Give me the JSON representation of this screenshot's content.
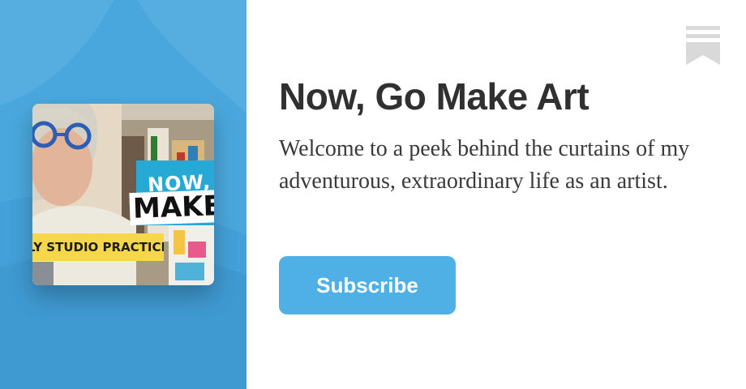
{
  "publication": {
    "title": "Now, Go Make Art",
    "description": "Welcome to a peek behind the curtains of my adventurous, extraordinary life as an artist.",
    "subscribe_label": "Subscribe"
  },
  "cover": {
    "title_line_1": "NOW, G",
    "title_line_2": "MAKE",
    "banner_text": "LY STUDIO PRACTICE"
  },
  "colors": {
    "panel_blue": "#4aa7dd",
    "subscribe_blue": "#4fb0e6",
    "title_text": "#303030",
    "bookmark_gray": "#d9d9d9"
  },
  "icons": {
    "bookmark": "bookmark-icon"
  }
}
